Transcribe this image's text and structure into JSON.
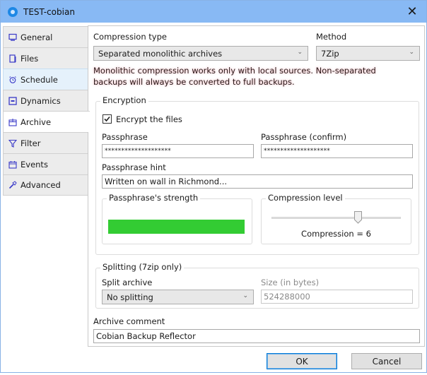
{
  "window": {
    "title": "TEST-cobian",
    "close_icon": "close-icon"
  },
  "sidebar": {
    "items": [
      {
        "label": "General",
        "icon": "monitor-icon",
        "state": "normal"
      },
      {
        "label": "Files",
        "icon": "files-icon",
        "state": "normal"
      },
      {
        "label": "Schedule",
        "icon": "alarm-clock-icon",
        "state": "hover"
      },
      {
        "label": "Dynamics",
        "icon": "dynamics-icon",
        "state": "normal"
      },
      {
        "label": "Archive",
        "icon": "archive-box-icon",
        "state": "active"
      },
      {
        "label": "Filter",
        "icon": "funnel-icon",
        "state": "normal"
      },
      {
        "label": "Events",
        "icon": "calendar-icon",
        "state": "normal"
      },
      {
        "label": "Advanced",
        "icon": "wrench-icon",
        "state": "normal"
      }
    ]
  },
  "archive": {
    "compression_type": {
      "label": "Compression type",
      "value": "Separated monolithic archives"
    },
    "method": {
      "label": "Method",
      "value": "7Zip"
    },
    "warning": "Monolithic compression works only with local sources. Non-separated backups will always be converted to full backups.",
    "warning_color": "#dc3c50",
    "encryption": {
      "title": "Encryption",
      "encrypt_label": "Encrypt the files",
      "encrypt_checked": true,
      "passphrase_label": "Passphrase",
      "passphrase_value": "********************",
      "confirm_label": "Passphrase (confirm)",
      "confirm_value": "********************",
      "hint_label": "Passphrase hint",
      "hint_value": "Written on wall in Richmond...",
      "strength": {
        "title": "Passphrase's strength",
        "percent": 100,
        "color": "#33cc33"
      },
      "compression_level": {
        "title": "Compression level",
        "value": 6,
        "min": 0,
        "max": 9,
        "readout": "Compression = 6"
      }
    },
    "splitting": {
      "title": "Splitting (7zip only)",
      "split_label": "Split archive",
      "split_value": "No splitting",
      "size_label": "Size (in bytes)",
      "size_value": "524288000"
    },
    "comment": {
      "label": "Archive comment",
      "value": "Cobian Backup Reflector"
    }
  },
  "buttons": {
    "ok": "OK",
    "cancel": "Cancel"
  },
  "colors": {
    "titlebar": "#88b9f4",
    "accent": "#0078d7",
    "icon": "#3a3ac8"
  }
}
